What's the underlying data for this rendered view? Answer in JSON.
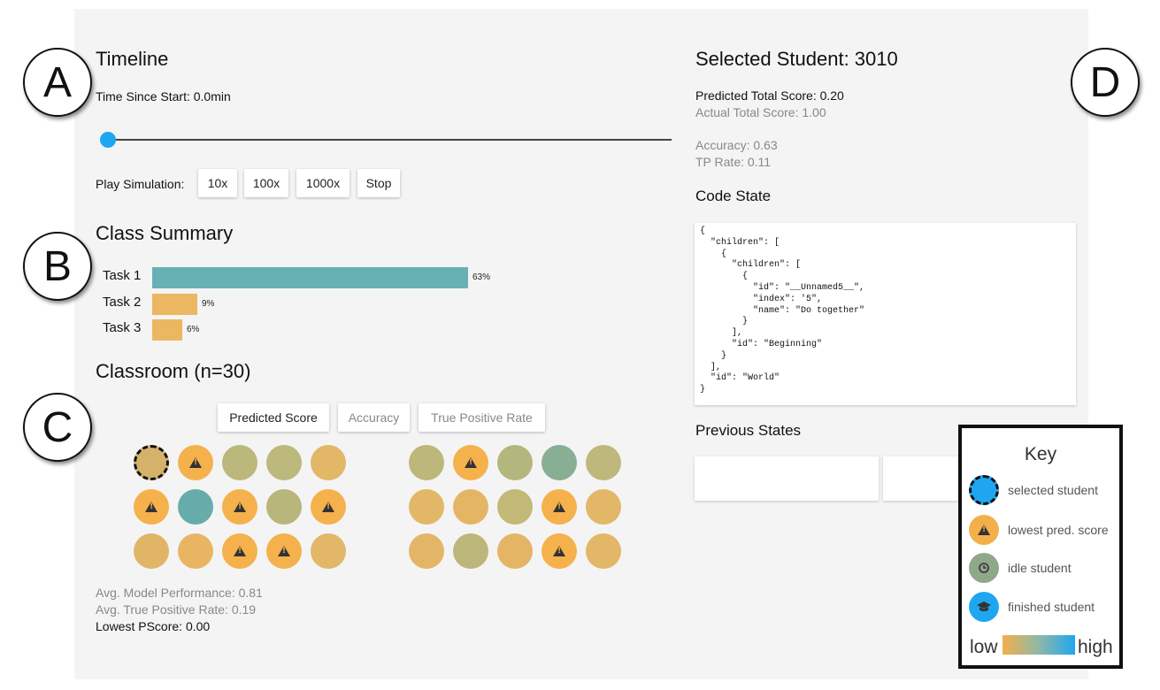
{
  "callouts": {
    "a": "A",
    "b": "B",
    "c": "C",
    "d": "D"
  },
  "timeline": {
    "title": "Timeline",
    "time_label": "Time Since Start: 0.0min",
    "slider_progress": 0.0,
    "play_label": "Play Simulation:",
    "buttons": [
      "10x",
      "100x",
      "1000x",
      "Stop"
    ]
  },
  "class_summary": {
    "title": "Class Summary",
    "tasks": [
      {
        "label": "Task 1",
        "pct": "63%",
        "value": 0.63,
        "color": "#67b1b5"
      },
      {
        "label": "Task 2",
        "pct": "9%",
        "value": 0.09,
        "color": "#ebb760"
      },
      {
        "label": "Task 3",
        "pct": "6%",
        "value": 0.06,
        "color": "#ebb760"
      }
    ]
  },
  "classroom": {
    "title": "Classroom (n=30)",
    "tabs": [
      "Predicted Score",
      "Accuracy",
      "True Positive Rate"
    ],
    "active_tab": 0,
    "left_group": [
      {
        "color": "#d4b26a",
        "icon": "",
        "selected": true
      },
      {
        "color": "#f5b14c",
        "icon": "warning"
      },
      {
        "color": "#bcb77a",
        "icon": ""
      },
      {
        "color": "#bdb87b",
        "icon": ""
      },
      {
        "color": "#e2b767",
        "icon": ""
      },
      {
        "color": "#f5b14c",
        "icon": "warning"
      },
      {
        "color": "#66acaa",
        "icon": ""
      },
      {
        "color": "#f5b14c",
        "icon": "warning"
      },
      {
        "color": "#b8b67a",
        "icon": ""
      },
      {
        "color": "#f5b14c",
        "icon": "warning"
      },
      {
        "color": "#e0b666",
        "icon": ""
      },
      {
        "color": "#eab562",
        "icon": ""
      },
      {
        "color": "#f5b14c",
        "icon": "warning"
      },
      {
        "color": "#f5b14c",
        "icon": "warning"
      },
      {
        "color": "#e2b767",
        "icon": ""
      }
    ],
    "right_group": [
      {
        "color": "#bcb77a",
        "icon": ""
      },
      {
        "color": "#f5b14c",
        "icon": "warning"
      },
      {
        "color": "#b3b67d",
        "icon": ""
      },
      {
        "color": "#88ae94",
        "icon": ""
      },
      {
        "color": "#bfb87c",
        "icon": ""
      },
      {
        "color": "#e2b767",
        "icon": ""
      },
      {
        "color": "#e5b566",
        "icon": ""
      },
      {
        "color": "#c2b877",
        "icon": ""
      },
      {
        "color": "#f5b14c",
        "icon": "warning"
      },
      {
        "color": "#e2b767",
        "icon": ""
      },
      {
        "color": "#e3b667",
        "icon": ""
      },
      {
        "color": "#bcb67a",
        "icon": ""
      },
      {
        "color": "#e5b566",
        "icon": ""
      },
      {
        "color": "#f5b14c",
        "icon": "warning"
      },
      {
        "color": "#e2b767",
        "icon": ""
      }
    ],
    "stats": {
      "model_performance": "Avg. Model Performance: 0.81",
      "tp_rate": "Avg. True Positive Rate: 0.19",
      "lowest": "Lowest PScore: 0.00"
    }
  },
  "student": {
    "title": "Selected Student: 3010",
    "predicted": "Predicted Total Score: 0.20",
    "actual": "Actual Total Score: 1.00",
    "accuracy": "Accuracy: 0.63",
    "tp_rate": "TP Rate: 0.11",
    "code_title": "Code State",
    "code": "{\n  \"children\": [\n    {\n      \"children\": [\n        {\n          \"id\": \"__Unnamed5__\",\n          \"index\": '5\",\n          \"name\": \"Do together\"\n        }\n      ],\n      \"id\": \"Beginning\"\n    }\n  ],\n  \"id\": \"World\"\n}",
    "previous_title": "Previous States"
  },
  "key": {
    "title": "Key",
    "items": [
      {
        "label": "selected student",
        "icon": "dashed-circle-icon",
        "color": "#1ea7f0"
      },
      {
        "label": "lowest pred. score",
        "icon": "warning-icon",
        "color": "#f3b04a"
      },
      {
        "label": "idle student",
        "icon": "clock-icon",
        "color": "#8fa88a"
      },
      {
        "label": "finished student",
        "icon": "graduation-cap-icon",
        "color": "#1ea7f0"
      }
    ],
    "low": "low",
    "high": "high"
  }
}
